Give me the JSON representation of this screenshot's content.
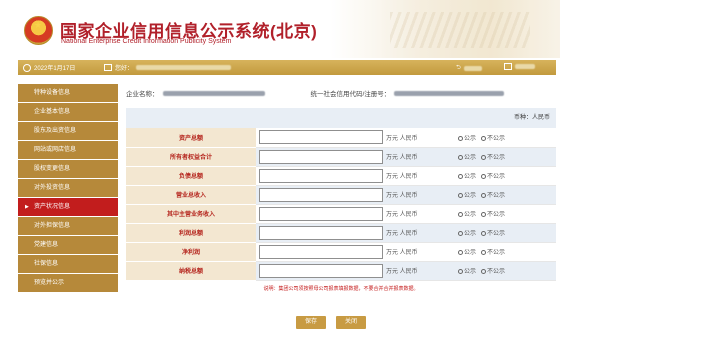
{
  "header": {
    "title": "国家企业信用信息公示系统(北京)",
    "subtitle": "National Enterprise Credit Information Publicity System"
  },
  "infobar": {
    "date": "2022年1月17日",
    "user_prefix": "您好："
  },
  "sidebar": {
    "items": [
      {
        "label": "特种设备信息",
        "active": false
      },
      {
        "label": "企业基本信息",
        "active": false
      },
      {
        "label": "股东及出资信息",
        "active": false
      },
      {
        "label": "网站或网店信息",
        "active": false
      },
      {
        "label": "股权变更信息",
        "active": false
      },
      {
        "label": "对外投资信息",
        "active": false
      },
      {
        "label": "资产状况信息",
        "active": true
      },
      {
        "label": "对外担保信息",
        "active": false
      },
      {
        "label": "党建信息",
        "active": false
      },
      {
        "label": "社保信息",
        "active": false
      },
      {
        "label": "预览并公示",
        "active": false
      }
    ]
  },
  "main": {
    "company_label": "企业名称：",
    "credit_label": "统一社会信用代码/注册号：",
    "currency_note": "币种：人民币",
    "rows": [
      {
        "label": "资产总额",
        "unit": "万元 人民币",
        "opt_public": "公示",
        "opt_private": "不公示"
      },
      {
        "label": "所有者权益合计",
        "unit": "万元 人民币",
        "opt_public": "公示",
        "opt_private": "不公示"
      },
      {
        "label": "负债总额",
        "unit": "万元 人民币",
        "opt_public": "公示",
        "opt_private": "不公示"
      },
      {
        "label": "营业总收入",
        "unit": "万元 人民币",
        "opt_public": "公示",
        "opt_private": "不公示"
      },
      {
        "label": "其中主营业务收入",
        "unit": "万元 人民币",
        "opt_public": "公示",
        "opt_private": "不公示"
      },
      {
        "label": "利润总额",
        "unit": "万元 人民币",
        "opt_public": "公示",
        "opt_private": "不公示"
      },
      {
        "label": "净利润",
        "unit": "万元 人民币",
        "opt_public": "公示",
        "opt_private": "不公示"
      },
      {
        "label": "纳税总额",
        "unit": "万元 人民币",
        "opt_public": "公示",
        "opt_private": "不公示"
      }
    ],
    "note": "说明：集团公司须按照母公司报表填报数据，不要合并合并报表数据。"
  },
  "buttons": {
    "save": "保存",
    "close": "关闭"
  },
  "colors": {
    "brand_red": "#b1202a",
    "nav_gold": "#b6893a",
    "nav_active": "#c21d1d",
    "bar_gold": "#c29a3e"
  }
}
